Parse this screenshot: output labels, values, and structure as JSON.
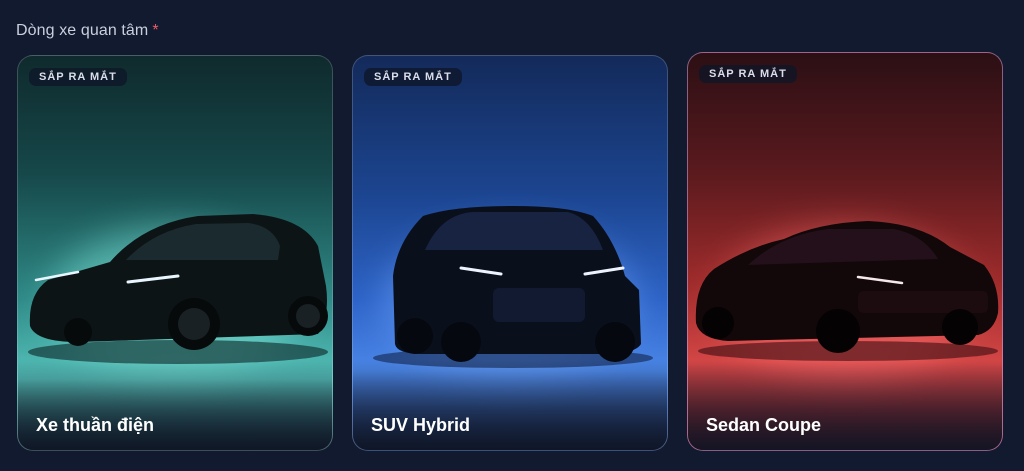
{
  "form": {
    "label": "Dòng xe quan tâm",
    "required_mark": "*"
  },
  "cards": [
    {
      "badge": "SẮP RA MẮT",
      "title": "Xe thuần điện",
      "accent": "#56c2bb"
    },
    {
      "badge": "SẮP RA MẮT",
      "title": "SUV Hybrid",
      "accent": "#4b87e8"
    },
    {
      "badge": "SẮP RA MẮT",
      "title": "Sedan Coupe",
      "accent": "#d34646",
      "selected": true
    }
  ],
  "colors": {
    "background": "#121a30",
    "required": "#ef5b6b",
    "selected_border": "#d6a0dc"
  }
}
